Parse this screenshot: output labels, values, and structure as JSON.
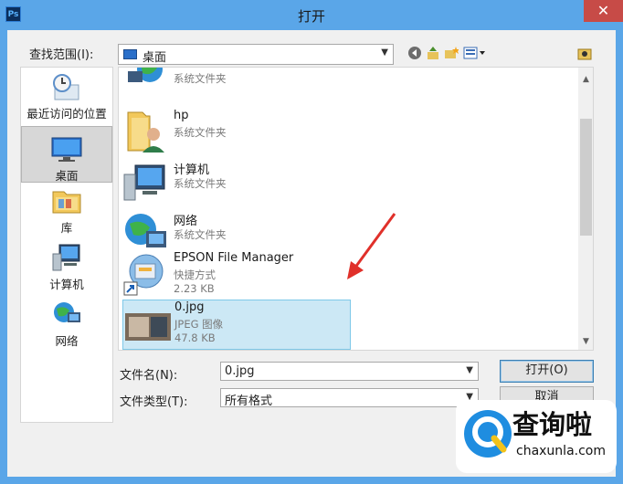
{
  "window": {
    "title": "打开",
    "app_icon": "Ps",
    "close": "✕"
  },
  "lookin": {
    "label": "查找范围(I):",
    "value": "桌面"
  },
  "places": [
    {
      "label": "最近访问的位置",
      "icon": "recent-places-icon"
    },
    {
      "label": "桌面",
      "icon": "desktop-icon",
      "selected": true
    },
    {
      "label": "库",
      "icon": "library-icon"
    },
    {
      "label": "计算机",
      "icon": "computer-icon"
    },
    {
      "label": "网络",
      "icon": "network-icon"
    }
  ],
  "files": [
    {
      "name": "",
      "type": "系统文件夹",
      "icon": "network-folder-icon"
    },
    {
      "name": "hp",
      "type": "系统文件夹",
      "icon": "user-folder-icon"
    },
    {
      "name": "计算机",
      "type": "系统文件夹",
      "icon": "computer-icon"
    },
    {
      "name": "网络",
      "type": "系统文件夹",
      "icon": "network-icon"
    },
    {
      "name": "EPSON File Manager",
      "type": "快捷方式",
      "size": "2.23 KB",
      "icon": "shortcut-icon"
    },
    {
      "name": "0.jpg",
      "type": "JPEG 图像",
      "size": "47.8 KB",
      "icon": "image-thumbnail-icon",
      "selected": true
    }
  ],
  "filename": {
    "label": "文件名(N):",
    "value": "0.jpg"
  },
  "filetype": {
    "label": "文件类型(T):",
    "value": "所有格式"
  },
  "buttons": {
    "open": "打开(O)",
    "cancel": "取消"
  },
  "watermark": {
    "cn": "查询啦",
    "en": "chaxunla.com"
  }
}
